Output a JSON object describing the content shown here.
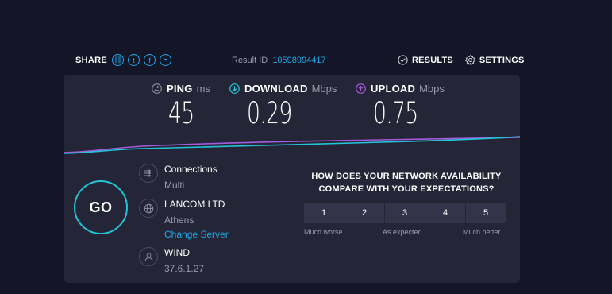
{
  "share": {
    "label": "SHARE",
    "buttons": [
      {
        "icon": "link-icon",
        "glyph": "⛓"
      },
      {
        "icon": "twitter-icon",
        "glyph": "t"
      },
      {
        "icon": "facebook-icon",
        "glyph": "f"
      },
      {
        "icon": "more-icon",
        "glyph": "•••"
      }
    ]
  },
  "result": {
    "label": "Result ID",
    "id": "10598994417"
  },
  "nav": {
    "results": "RESULTS",
    "settings": "SETTINGS"
  },
  "metrics": {
    "ping": {
      "name": "PING",
      "unit": "ms",
      "value": "45",
      "color": "#8f90a6"
    },
    "download": {
      "name": "DOWNLOAD",
      "unit": "Mbps",
      "value": "0.29",
      "color": "#22c5d8"
    },
    "upload": {
      "name": "UPLOAD",
      "unit": "Mbps",
      "value": "0.75",
      "color": "#a45bdb"
    }
  },
  "go": {
    "label": "GO"
  },
  "connection": {
    "title": "Connections",
    "value": "Multi"
  },
  "server": {
    "name": "LANCOM LTD",
    "location": "Athens",
    "change": "Change Server"
  },
  "provider": {
    "name": "WIND",
    "ip": "37.6.1.27"
  },
  "survey": {
    "question": "HOW DOES YOUR NETWORK AVAILABILITY COMPARE WITH YOUR EXPECTATIONS?",
    "options": [
      "1",
      "2",
      "3",
      "4",
      "5"
    ],
    "low_label": "Much worse",
    "mid_label": "As expected",
    "high_label": "Much better"
  },
  "colors": {
    "accent": "#1ea7e5",
    "download": "#22c5d8",
    "upload": "#a45bdb",
    "background": "#141526",
    "panel": "#242536"
  }
}
